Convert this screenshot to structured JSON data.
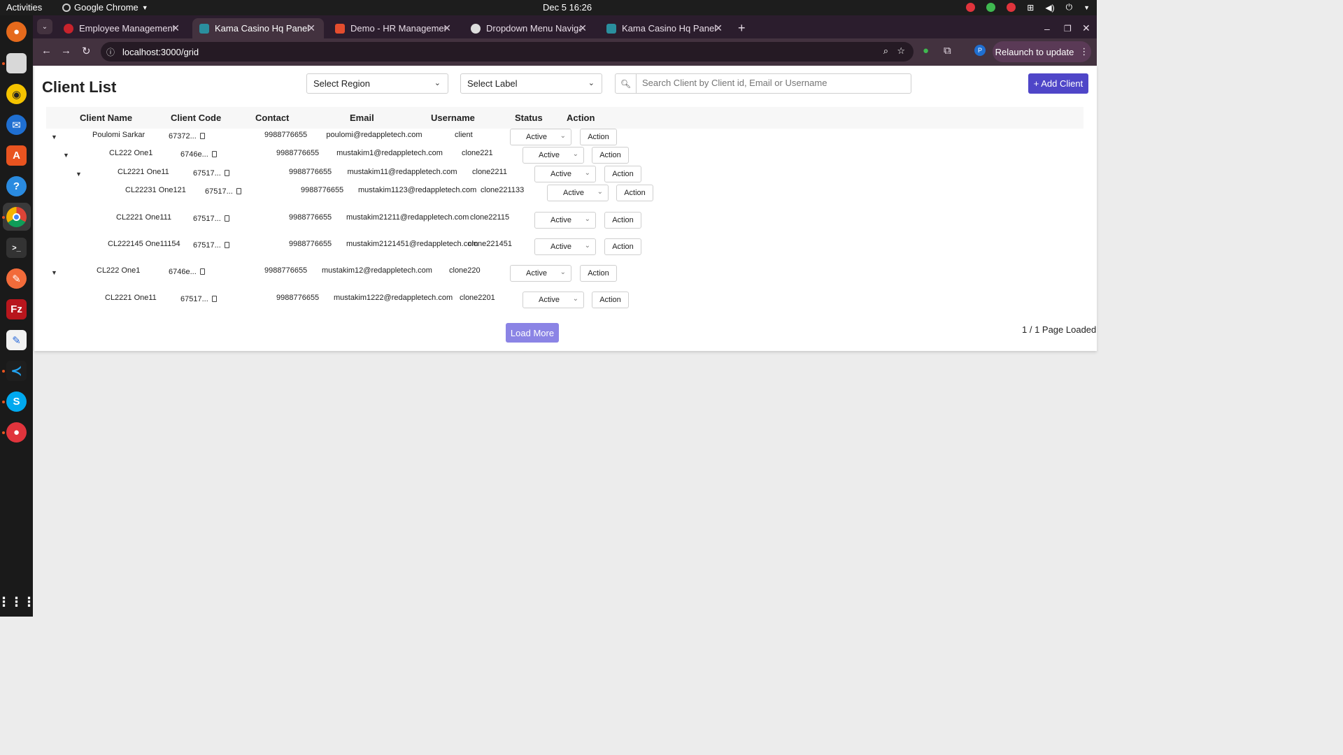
{
  "system": {
    "activities": "Activities",
    "app_name": "Google Chrome",
    "clock": "Dec 5  16:26"
  },
  "browser": {
    "tabs": [
      {
        "label": "Employee Management",
        "active": false
      },
      {
        "label": "Kama Casino Hq Panel",
        "active": true
      },
      {
        "label": "Demo - HR Management",
        "active": false
      },
      {
        "label": "Dropdown Menu Naviga",
        "active": false
      },
      {
        "label": "Kama Casino Hq Panel",
        "active": false
      }
    ],
    "url": "localhost:3000/grid",
    "relaunch_label": "Relaunch to update",
    "profile_initial": "P"
  },
  "page": {
    "title": "Client List",
    "region_select": "Select Region",
    "label_select": "Select Label",
    "search_placeholder": "Search Client by Client id, Email or Username",
    "add_button": "+ Add Client",
    "columns": [
      "Client Name",
      "Client Code",
      "Contact",
      "Email",
      "Username",
      "Status",
      "Action"
    ],
    "rows": [
      {
        "level": 0,
        "expandable": true,
        "name": "Poulomi Sarkar",
        "code": "67372...",
        "contact": "9988776655",
        "email": "poulomi@redappletech.com",
        "username": "client",
        "status": "Active",
        "action": "Action"
      },
      {
        "level": 1,
        "expandable": true,
        "name": "CL222 One1",
        "code": "6746e...",
        "contact": "9988776655",
        "email": "mustakim1@redappletech.com",
        "username": "clone221",
        "status": "Active",
        "action": "Action"
      },
      {
        "level": 2,
        "expandable": true,
        "name": "CL2221 One11",
        "code": "67517...",
        "contact": "9988776655",
        "email": "mustakim11@redappletech.com",
        "username": "clone2211",
        "status": "Active",
        "action": "Action"
      },
      {
        "level": 3,
        "expandable": false,
        "name": "CL22231 One121",
        "code": "67517...",
        "contact": "9988776655",
        "email": "mustakim1123@redappletech.com",
        "username": "clone221133",
        "status": "Active",
        "action": "Action"
      },
      {
        "level": 2,
        "expandable": false,
        "name": "CL2221 One111",
        "code": "67517...",
        "contact": "9988776655",
        "email": "mustakim21211@redappletech.com",
        "username": "clone22115",
        "status": "Active",
        "action": "Action"
      },
      {
        "level": 2,
        "expandable": false,
        "name": "CL222145 One11154",
        "code": "67517...",
        "contact": "9988776655",
        "email": "mustakim2121451@redappletech.com",
        "username": "clone221451",
        "status": "Active",
        "action": "Action"
      },
      {
        "level": 0,
        "expandable": true,
        "name": "CL222 One1",
        "code": "6746e...",
        "contact": "9988776655",
        "email": "mustakim12@redappletech.com",
        "username": "clone220",
        "status": "Active",
        "action": "Action"
      },
      {
        "level": 1,
        "expandable": false,
        "name": "CL2221 One11",
        "code": "67517...",
        "contact": "9988776655",
        "email": "mustakim1222@redappletech.com",
        "username": "clone2201",
        "status": "Active",
        "action": "Action"
      }
    ],
    "load_more": "Load More",
    "page_info": "1 / 1 Page Loaded"
  },
  "colors": {
    "primary": "#4f46c8",
    "load_more": "#8b84e5",
    "chrome_frame": "#2b1d2d"
  }
}
